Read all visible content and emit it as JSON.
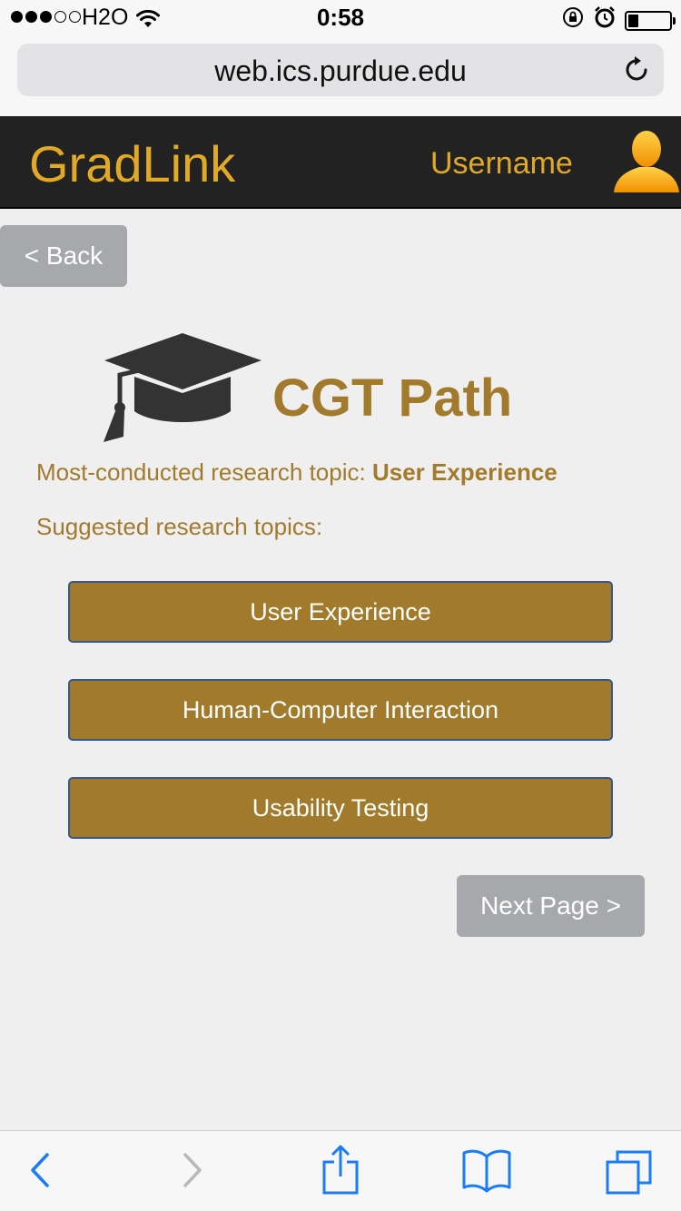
{
  "status_bar": {
    "carrier": "H2O",
    "time": "0:58",
    "battery_level": 0.25,
    "signal_bars_filled": 3,
    "signal_bars_total": 5
  },
  "browser": {
    "url": "web.ics.purdue.edu"
  },
  "header": {
    "brand": "GradLink",
    "username": "Username"
  },
  "nav": {
    "back_label": "< Back",
    "next_label": "Next Page >"
  },
  "main": {
    "title": "CGT Path",
    "most_conducted_label": "Most-conducted research topic: ",
    "most_conducted_value": "User Experience",
    "suggested_label": "Suggested research topics:",
    "topics": [
      {
        "label": "User Experience"
      },
      {
        "label": "Human-Computer Interaction"
      },
      {
        "label": "Usability Testing"
      }
    ]
  },
  "colors": {
    "brand_gold": "#e1a925",
    "accent_gold": "#a27a2c",
    "header_bg": "#222222",
    "button_gray": "#a7a8ab",
    "ios_blue": "#1a7cf6"
  },
  "icons": {
    "wifi": "wifi-icon",
    "rotation_lock": "rotation-lock-icon",
    "alarm": "alarm-icon",
    "battery": "battery-icon",
    "reload": "reload-icon",
    "avatar": "user-silhouette-icon",
    "graduation_cap": "graduation-cap-icon",
    "toolbar": [
      "back-arrow-icon",
      "forward-arrow-icon",
      "share-icon",
      "bookmarks-icon",
      "tabs-icon"
    ]
  }
}
